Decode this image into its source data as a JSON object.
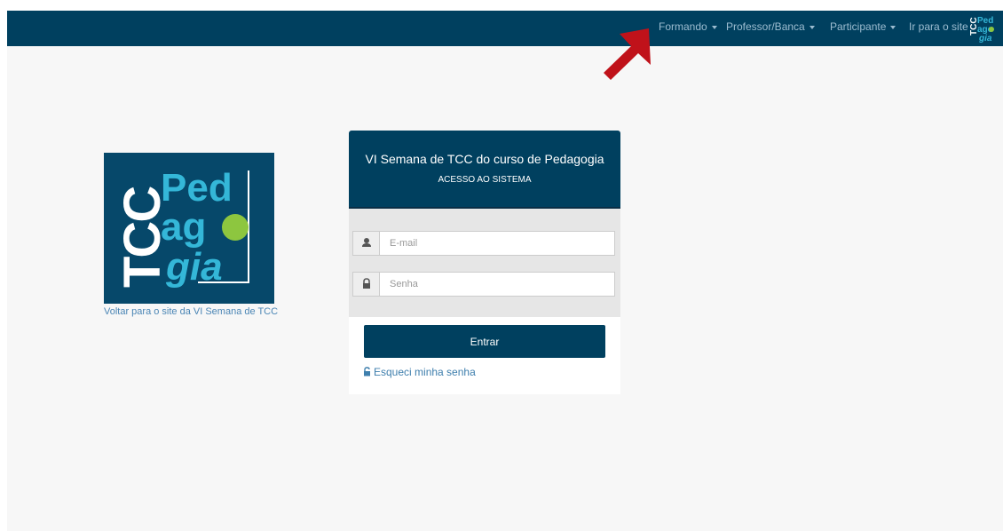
{
  "topbar": {
    "menus": [
      {
        "label": "Formando"
      },
      {
        "label": "Professor/Banca"
      },
      {
        "label": "Participante"
      }
    ],
    "site_link": "Ir para o site",
    "bg_color": "#00405f"
  },
  "logo": {
    "text_lines": [
      "TCC",
      "Ped",
      "ago",
      "gia"
    ],
    "caption_link": "Voltar para o site da VI Semana de TCC"
  },
  "login": {
    "title": "VI Semana de TCC do curso de Pedagogia",
    "subtitle": "ACESSO AO SISTEMA",
    "email_placeholder": "E-mail",
    "email_value": "",
    "password_placeholder": "Senha",
    "password_value": "",
    "submit_label": "Entrar",
    "forgot_link": "Esqueci minha senha"
  },
  "icons": {
    "user": "user-icon",
    "lock": "lock-icon",
    "unlock": "unlock-icon",
    "arrow": "red-arrow-annotation"
  },
  "colors": {
    "primary": "#00405f",
    "logo_accent": "#34b7d8",
    "logo_dot": "#8dc63f",
    "arrow": "#c0121a"
  }
}
